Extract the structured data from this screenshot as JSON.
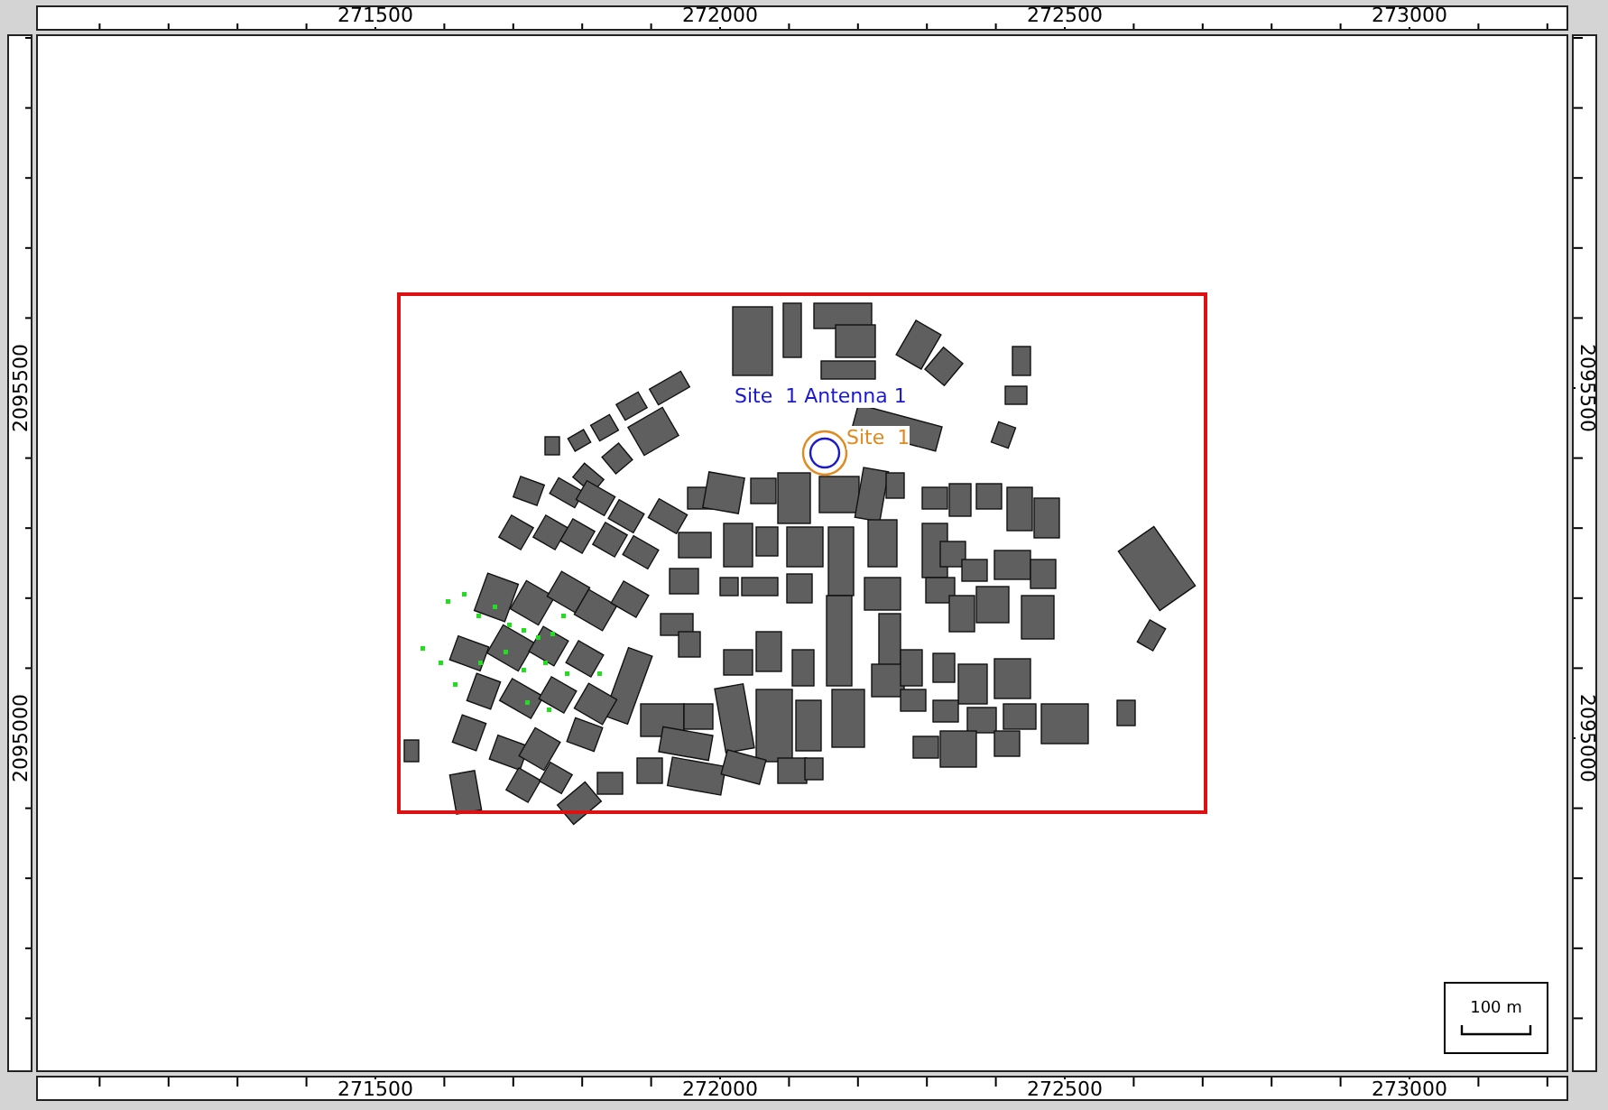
{
  "rulers": {
    "top_labels": [
      "271500",
      "272000",
      "272500",
      "273000"
    ],
    "left_labels": [
      "2095500",
      "2095000"
    ],
    "right_labels": [
      "2095500",
      "2095000"
    ],
    "bottom_labels": [
      "271500",
      "272000",
      "272500",
      "273000"
    ]
  },
  "map": {
    "site_labels": [
      {
        "text": "Site  1 Antenna 1",
        "kind": "antenna"
      },
      {
        "text": "Site  1",
        "kind": "site"
      }
    ],
    "scale_bar": {
      "label": "100 m"
    }
  }
}
